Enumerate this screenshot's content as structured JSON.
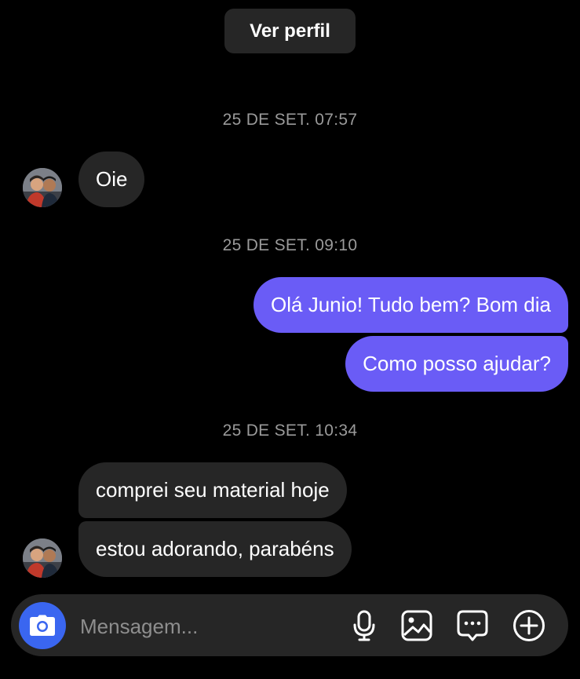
{
  "header": {
    "view_profile_label": "Ver perfil"
  },
  "messages": {
    "group1": {
      "timestamp": "25 DE SET. 07:57",
      "received": [
        "Oie"
      ]
    },
    "group2": {
      "timestamp": "25 DE SET. 09:10",
      "sent": [
        "Olá Junio! Tudo bem? Bom dia",
        "Como posso ajudar?"
      ]
    },
    "group3": {
      "timestamp": "25 DE SET. 10:34",
      "received": [
        "comprei seu material hoje",
        "estou adorando, parabéns"
      ]
    }
  },
  "composer": {
    "placeholder": "Mensagem...",
    "icons": [
      "camera-icon",
      "microphone-icon",
      "gallery-icon",
      "sticker-chat-icon",
      "plus-circle-icon"
    ]
  },
  "colors": {
    "background": "#000000",
    "received_bubble": "#262626",
    "sent_bubble": "#6a5cf6",
    "camera_button": "#3a66f0",
    "timestamp_text": "#9a9a9a"
  }
}
